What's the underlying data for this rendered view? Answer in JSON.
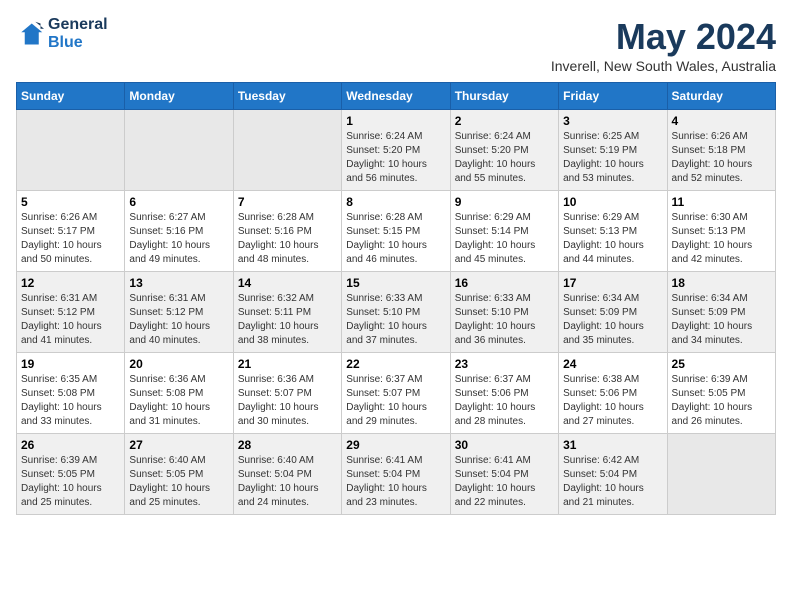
{
  "header": {
    "logo_line1": "General",
    "logo_line2": "Blue",
    "month_title": "May 2024",
    "subtitle": "Inverell, New South Wales, Australia"
  },
  "days_of_week": [
    "Sunday",
    "Monday",
    "Tuesday",
    "Wednesday",
    "Thursday",
    "Friday",
    "Saturday"
  ],
  "weeks": [
    [
      {
        "day": "",
        "info": ""
      },
      {
        "day": "",
        "info": ""
      },
      {
        "day": "",
        "info": ""
      },
      {
        "day": "1",
        "info": "Sunrise: 6:24 AM\nSunset: 5:20 PM\nDaylight: 10 hours\nand 56 minutes."
      },
      {
        "day": "2",
        "info": "Sunrise: 6:24 AM\nSunset: 5:20 PM\nDaylight: 10 hours\nand 55 minutes."
      },
      {
        "day": "3",
        "info": "Sunrise: 6:25 AM\nSunset: 5:19 PM\nDaylight: 10 hours\nand 53 minutes."
      },
      {
        "day": "4",
        "info": "Sunrise: 6:26 AM\nSunset: 5:18 PM\nDaylight: 10 hours\nand 52 minutes."
      }
    ],
    [
      {
        "day": "5",
        "info": "Sunrise: 6:26 AM\nSunset: 5:17 PM\nDaylight: 10 hours\nand 50 minutes."
      },
      {
        "day": "6",
        "info": "Sunrise: 6:27 AM\nSunset: 5:16 PM\nDaylight: 10 hours\nand 49 minutes."
      },
      {
        "day": "7",
        "info": "Sunrise: 6:28 AM\nSunset: 5:16 PM\nDaylight: 10 hours\nand 48 minutes."
      },
      {
        "day": "8",
        "info": "Sunrise: 6:28 AM\nSunset: 5:15 PM\nDaylight: 10 hours\nand 46 minutes."
      },
      {
        "day": "9",
        "info": "Sunrise: 6:29 AM\nSunset: 5:14 PM\nDaylight: 10 hours\nand 45 minutes."
      },
      {
        "day": "10",
        "info": "Sunrise: 6:29 AM\nSunset: 5:13 PM\nDaylight: 10 hours\nand 44 minutes."
      },
      {
        "day": "11",
        "info": "Sunrise: 6:30 AM\nSunset: 5:13 PM\nDaylight: 10 hours\nand 42 minutes."
      }
    ],
    [
      {
        "day": "12",
        "info": "Sunrise: 6:31 AM\nSunset: 5:12 PM\nDaylight: 10 hours\nand 41 minutes."
      },
      {
        "day": "13",
        "info": "Sunrise: 6:31 AM\nSunset: 5:12 PM\nDaylight: 10 hours\nand 40 minutes."
      },
      {
        "day": "14",
        "info": "Sunrise: 6:32 AM\nSunset: 5:11 PM\nDaylight: 10 hours\nand 38 minutes."
      },
      {
        "day": "15",
        "info": "Sunrise: 6:33 AM\nSunset: 5:10 PM\nDaylight: 10 hours\nand 37 minutes."
      },
      {
        "day": "16",
        "info": "Sunrise: 6:33 AM\nSunset: 5:10 PM\nDaylight: 10 hours\nand 36 minutes."
      },
      {
        "day": "17",
        "info": "Sunrise: 6:34 AM\nSunset: 5:09 PM\nDaylight: 10 hours\nand 35 minutes."
      },
      {
        "day": "18",
        "info": "Sunrise: 6:34 AM\nSunset: 5:09 PM\nDaylight: 10 hours\nand 34 minutes."
      }
    ],
    [
      {
        "day": "19",
        "info": "Sunrise: 6:35 AM\nSunset: 5:08 PM\nDaylight: 10 hours\nand 33 minutes."
      },
      {
        "day": "20",
        "info": "Sunrise: 6:36 AM\nSunset: 5:08 PM\nDaylight: 10 hours\nand 31 minutes."
      },
      {
        "day": "21",
        "info": "Sunrise: 6:36 AM\nSunset: 5:07 PM\nDaylight: 10 hours\nand 30 minutes."
      },
      {
        "day": "22",
        "info": "Sunrise: 6:37 AM\nSunset: 5:07 PM\nDaylight: 10 hours\nand 29 minutes."
      },
      {
        "day": "23",
        "info": "Sunrise: 6:37 AM\nSunset: 5:06 PM\nDaylight: 10 hours\nand 28 minutes."
      },
      {
        "day": "24",
        "info": "Sunrise: 6:38 AM\nSunset: 5:06 PM\nDaylight: 10 hours\nand 27 minutes."
      },
      {
        "day": "25",
        "info": "Sunrise: 6:39 AM\nSunset: 5:05 PM\nDaylight: 10 hours\nand 26 minutes."
      }
    ],
    [
      {
        "day": "26",
        "info": "Sunrise: 6:39 AM\nSunset: 5:05 PM\nDaylight: 10 hours\nand 25 minutes."
      },
      {
        "day": "27",
        "info": "Sunrise: 6:40 AM\nSunset: 5:05 PM\nDaylight: 10 hours\nand 25 minutes."
      },
      {
        "day": "28",
        "info": "Sunrise: 6:40 AM\nSunset: 5:04 PM\nDaylight: 10 hours\nand 24 minutes."
      },
      {
        "day": "29",
        "info": "Sunrise: 6:41 AM\nSunset: 5:04 PM\nDaylight: 10 hours\nand 23 minutes."
      },
      {
        "day": "30",
        "info": "Sunrise: 6:41 AM\nSunset: 5:04 PM\nDaylight: 10 hours\nand 22 minutes."
      },
      {
        "day": "31",
        "info": "Sunrise: 6:42 AM\nSunset: 5:04 PM\nDaylight: 10 hours\nand 21 minutes."
      },
      {
        "day": "",
        "info": ""
      }
    ]
  ],
  "shaded_rows": [
    0,
    2,
    4
  ],
  "accent_color": "#2176c7"
}
